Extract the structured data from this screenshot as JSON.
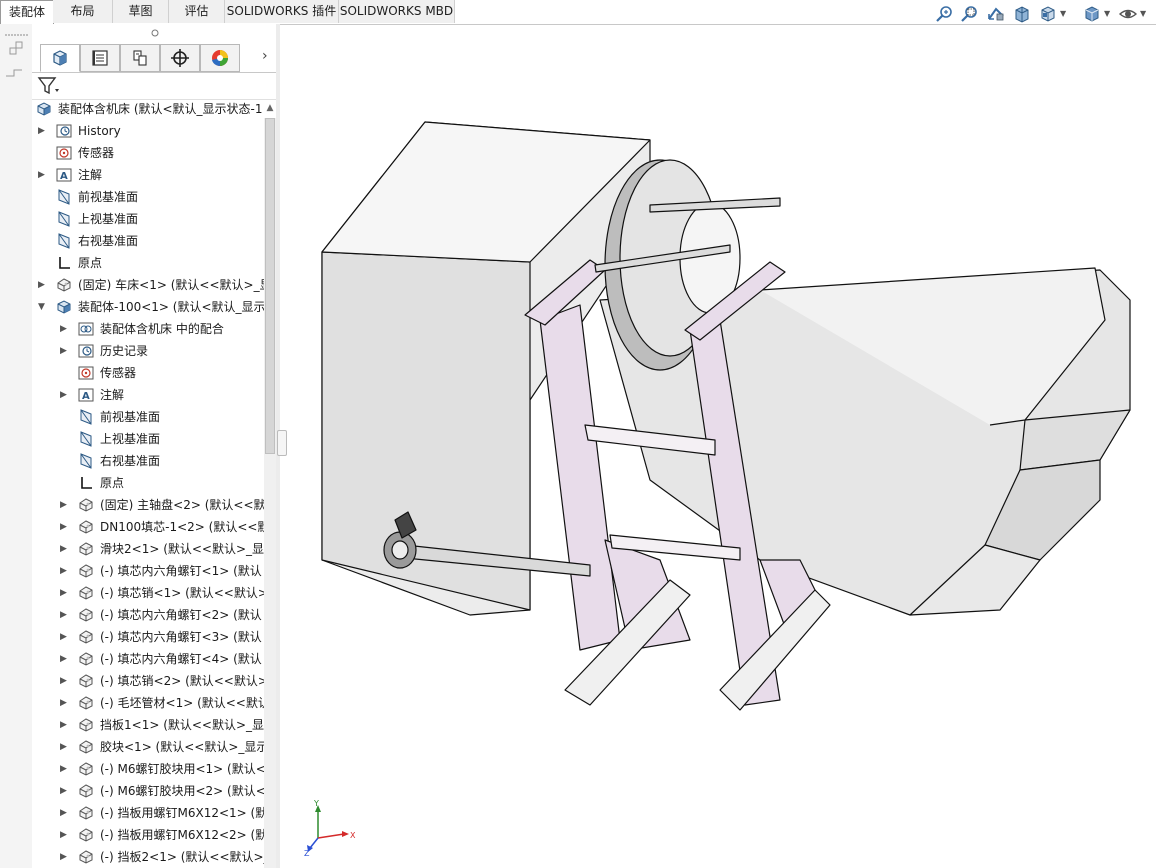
{
  "command_tabs": [
    "装配体",
    "布局",
    "草图",
    "评估",
    "SOLIDWORKS 插件",
    "SOLIDWORKS MBD"
  ],
  "active_tab": "装配体",
  "view_toolbar": [
    "zoom-to-fit-icon",
    "zoom-to-area-icon",
    "previous-view-icon",
    "section-view-icon",
    "view-orientation-icon",
    "display-style-icon",
    "hide-show-items-icon"
  ],
  "panel_tabs": [
    "featuremanager-icon",
    "propertymanager-icon",
    "configurationmanager-icon",
    "dimxpert-icon",
    "displaymanager-icon"
  ],
  "tree": {
    "root": "装配体含机床 (默认<默认_显示状态-1",
    "items": [
      {
        "label": "History",
        "icon": "history-icon",
        "arrow": true,
        "level": 1
      },
      {
        "label": "传感器",
        "icon": "sensor-icon",
        "arrow": false,
        "level": 1
      },
      {
        "label": "注解",
        "icon": "annotation-icon",
        "arrow": true,
        "level": 1
      },
      {
        "label": "前视基准面",
        "icon": "plane-icon",
        "arrow": false,
        "level": 1
      },
      {
        "label": "上视基准面",
        "icon": "plane-icon",
        "arrow": false,
        "level": 1
      },
      {
        "label": "右视基准面",
        "icon": "plane-icon",
        "arrow": false,
        "level": 1
      },
      {
        "label": "原点",
        "icon": "origin-icon",
        "arrow": false,
        "level": 1
      },
      {
        "label": "(固定) 车床<1> (默认<<默认>_显示",
        "icon": "part-icon",
        "arrow": true,
        "level": 1
      },
      {
        "label": "装配体-100<1> (默认<默认_显示",
        "icon": "assembly-icon",
        "arrow": true,
        "expanded": true,
        "level": 1
      },
      {
        "label": "装配体含机床 中的配合",
        "icon": "mates-icon",
        "arrow": true,
        "level": 2
      },
      {
        "label": "历史记录",
        "icon": "history-icon",
        "arrow": true,
        "level": 2
      },
      {
        "label": "传感器",
        "icon": "sensor-icon",
        "arrow": false,
        "level": 2
      },
      {
        "label": "注解",
        "icon": "annotation-icon",
        "arrow": true,
        "level": 2
      },
      {
        "label": "前视基准面",
        "icon": "plane-icon",
        "arrow": false,
        "level": 2
      },
      {
        "label": "上视基准面",
        "icon": "plane-icon",
        "arrow": false,
        "level": 2
      },
      {
        "label": "右视基准面",
        "icon": "plane-icon",
        "arrow": false,
        "level": 2
      },
      {
        "label": "原点",
        "icon": "origin-icon",
        "arrow": false,
        "level": 2
      },
      {
        "label": "(固定) 主轴盘<2> (默认<<默",
        "icon": "part-icon",
        "arrow": true,
        "level": 2
      },
      {
        "label": "DN100填芯-1<2> (默认<<默",
        "icon": "part-icon",
        "arrow": true,
        "level": 2
      },
      {
        "label": "滑块2<1> (默认<<默认>_显示",
        "icon": "part-icon",
        "arrow": true,
        "level": 2
      },
      {
        "label": "(-) 填芯内六角螺钉<1> (默认",
        "icon": "part-icon",
        "arrow": true,
        "level": 2
      },
      {
        "label": "(-) 填芯销<1> (默认<<默认>",
        "icon": "part-icon",
        "arrow": true,
        "level": 2
      },
      {
        "label": "(-) 填芯内六角螺钉<2> (默认",
        "icon": "part-icon",
        "arrow": true,
        "level": 2
      },
      {
        "label": "(-) 填芯内六角螺钉<3> (默认",
        "icon": "part-icon",
        "arrow": true,
        "level": 2
      },
      {
        "label": "(-) 填芯内六角螺钉<4> (默认",
        "icon": "part-icon",
        "arrow": true,
        "level": 2
      },
      {
        "label": "(-) 填芯销<2> (默认<<默认>",
        "icon": "part-icon",
        "arrow": true,
        "level": 2
      },
      {
        "label": "(-) 毛坯管材<1> (默认<<默认",
        "icon": "part-icon",
        "arrow": true,
        "level": 2
      },
      {
        "label": "挡板1<1> (默认<<默认>_显示",
        "icon": "part-icon",
        "arrow": true,
        "level": 2
      },
      {
        "label": "胶块<1> (默认<<默认>_显示",
        "icon": "part-icon",
        "arrow": true,
        "level": 2
      },
      {
        "label": "(-) M6螺钉胶块用<1> (默认<",
        "icon": "part-icon",
        "arrow": true,
        "level": 2
      },
      {
        "label": "(-) M6螺钉胶块用<2> (默认<",
        "icon": "part-icon",
        "arrow": true,
        "level": 2
      },
      {
        "label": "(-) 挡板用螺钉M6X12<1> (默",
        "icon": "part-icon",
        "arrow": true,
        "level": 2
      },
      {
        "label": "(-) 挡板用螺钉M6X12<2> (默",
        "icon": "part-icon",
        "arrow": true,
        "level": 2
      },
      {
        "label": "(-) 挡板2<1> (默认<<默认>_显",
        "icon": "part-icon",
        "arrow": true,
        "level": 2
      }
    ]
  },
  "triad": {
    "x": "X",
    "y": "Y",
    "z": "Z"
  },
  "colors": {
    "model_fill": "#eeeeee",
    "model_shadow": "#d6d6d6",
    "accent_purple": "#e8dcea",
    "edge": "#111111"
  }
}
